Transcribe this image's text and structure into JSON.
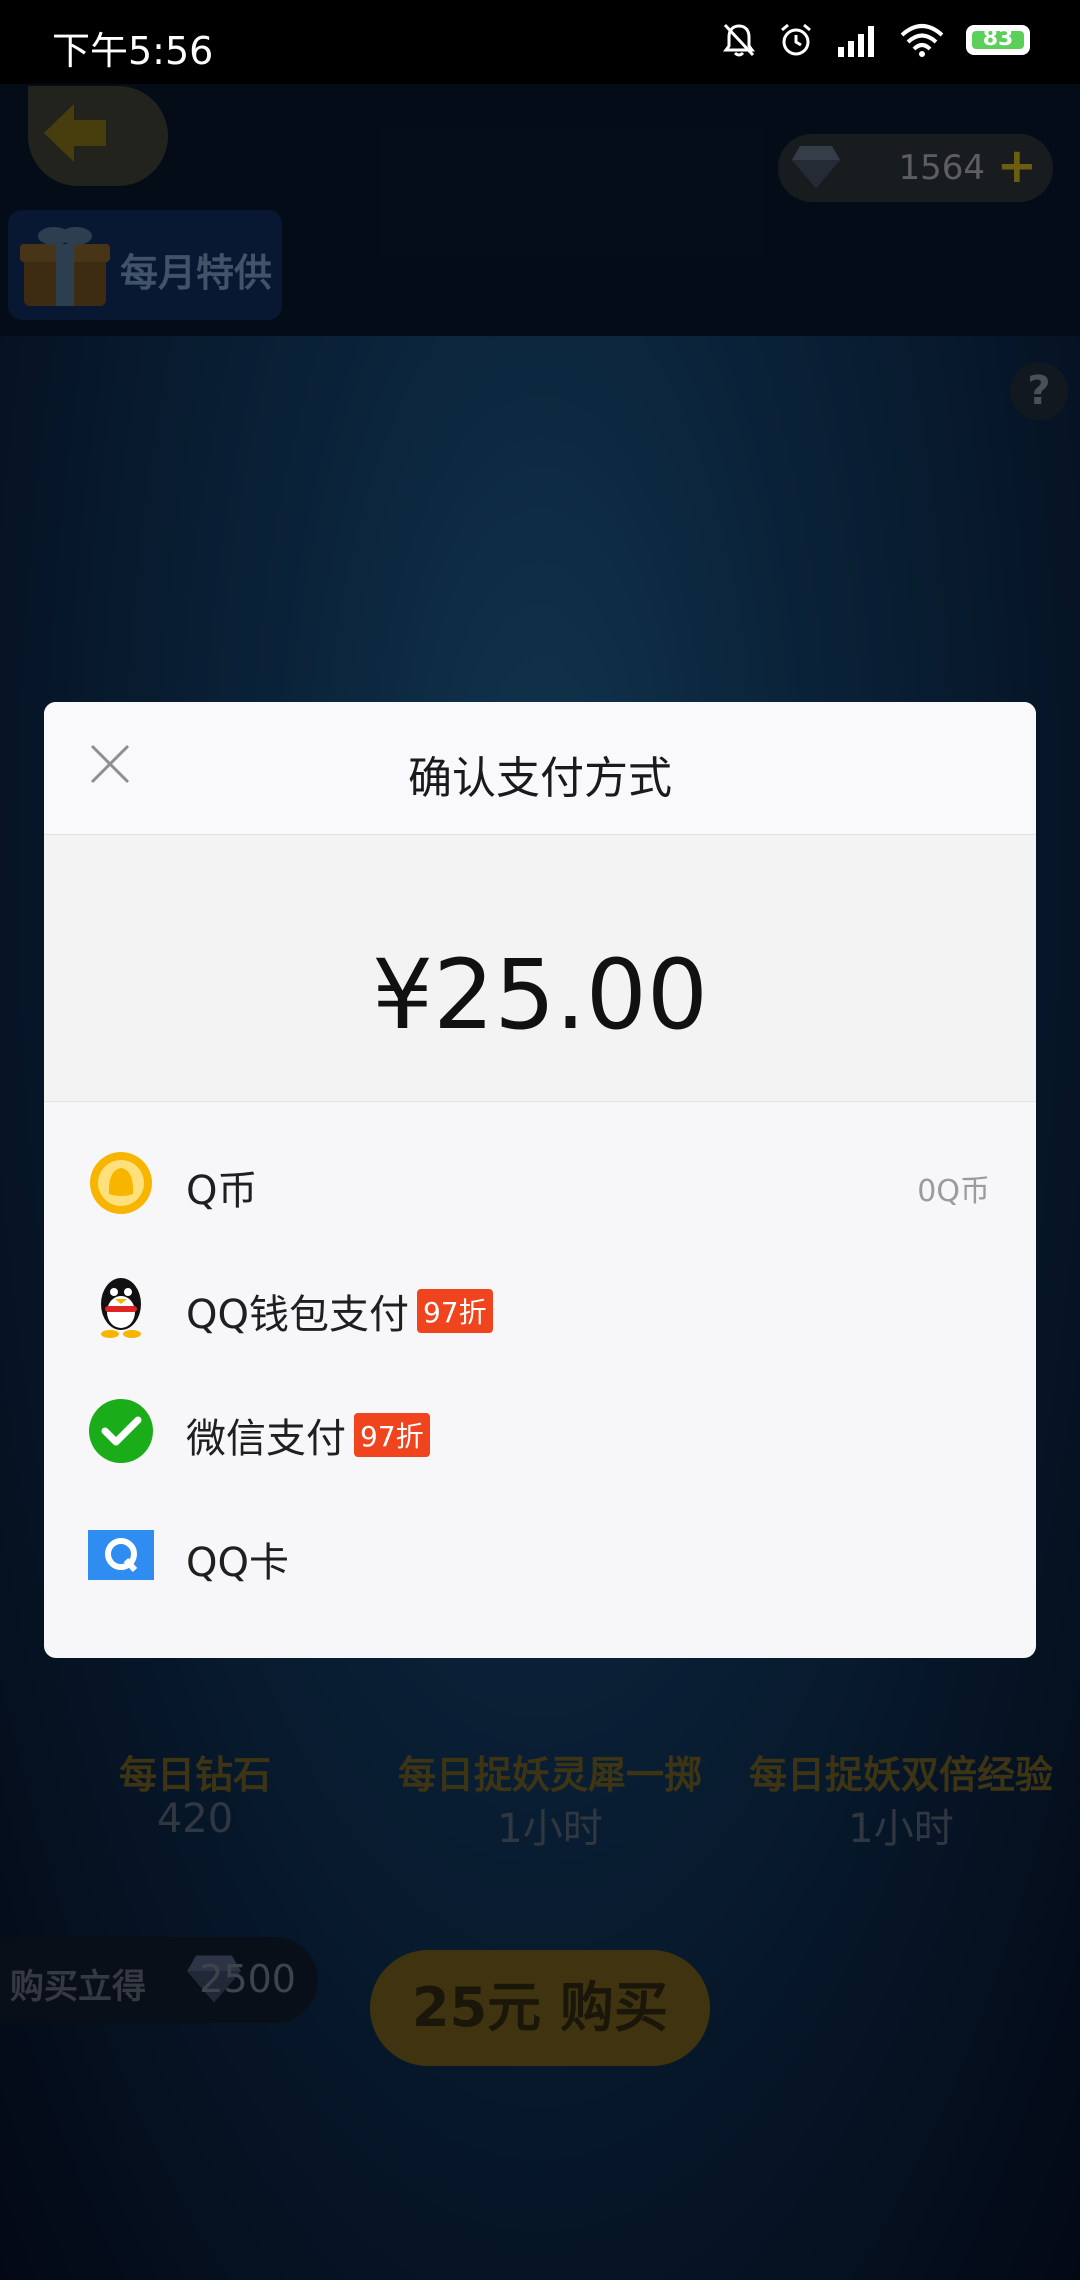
{
  "status_bar": {
    "time": "下午5:56",
    "battery": "83",
    "icons": [
      "mute-bell-icon",
      "alarm-icon",
      "signal-icon",
      "wifi-icon",
      "battery-icon"
    ]
  },
  "game": {
    "diamond_count": "1564",
    "diamond_plus": "+",
    "monthly_tab_label": "每月特供",
    "help_label": "?",
    "rewards": [
      {
        "name": "每日钻石",
        "value": "420"
      },
      {
        "name": "每日捉妖灵犀一掷",
        "value": "1小时"
      },
      {
        "name": "每日捉妖双倍经验",
        "value": "1小时"
      }
    ],
    "buy_get_label": "购买立得",
    "buy_get_value": "2500",
    "buy_button": "25元 购买"
  },
  "dialog": {
    "title": "确认支付方式",
    "amount": "¥25.00",
    "methods": [
      {
        "label": "Q币",
        "icon": "qcoin-icon",
        "balance": "0Q币",
        "badge": ""
      },
      {
        "label": "QQ钱包支付",
        "icon": "qq-penguin-icon",
        "balance": "",
        "badge": "97折"
      },
      {
        "label": "微信支付",
        "icon": "wechat-icon",
        "balance": "",
        "badge": "97折"
      },
      {
        "label": "QQ卡",
        "icon": "qq-card-icon",
        "balance": "",
        "badge": ""
      }
    ]
  },
  "colors": {
    "badge": "#f0441f",
    "wechat_green": "#1aad19",
    "qcoin_yellow": "#f7b500",
    "qqcard_blue": "#2f8cf0"
  }
}
